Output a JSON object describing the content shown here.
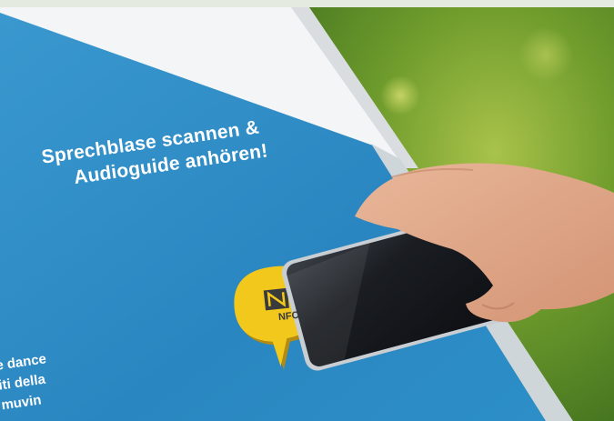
{
  "sign": {
    "headline_line1": "Sprechblase scannen &",
    "headline_line2": "Audioguide anhören!",
    "partial_line1": "e dance",
    "partial_line2": "iti della",
    "partial_line3": "muvin"
  },
  "tag": {
    "label": "NFC",
    "color": "#f2c81c"
  },
  "colors": {
    "sign_blue": "#2f8fc6",
    "grass": "#6a9a2e"
  }
}
